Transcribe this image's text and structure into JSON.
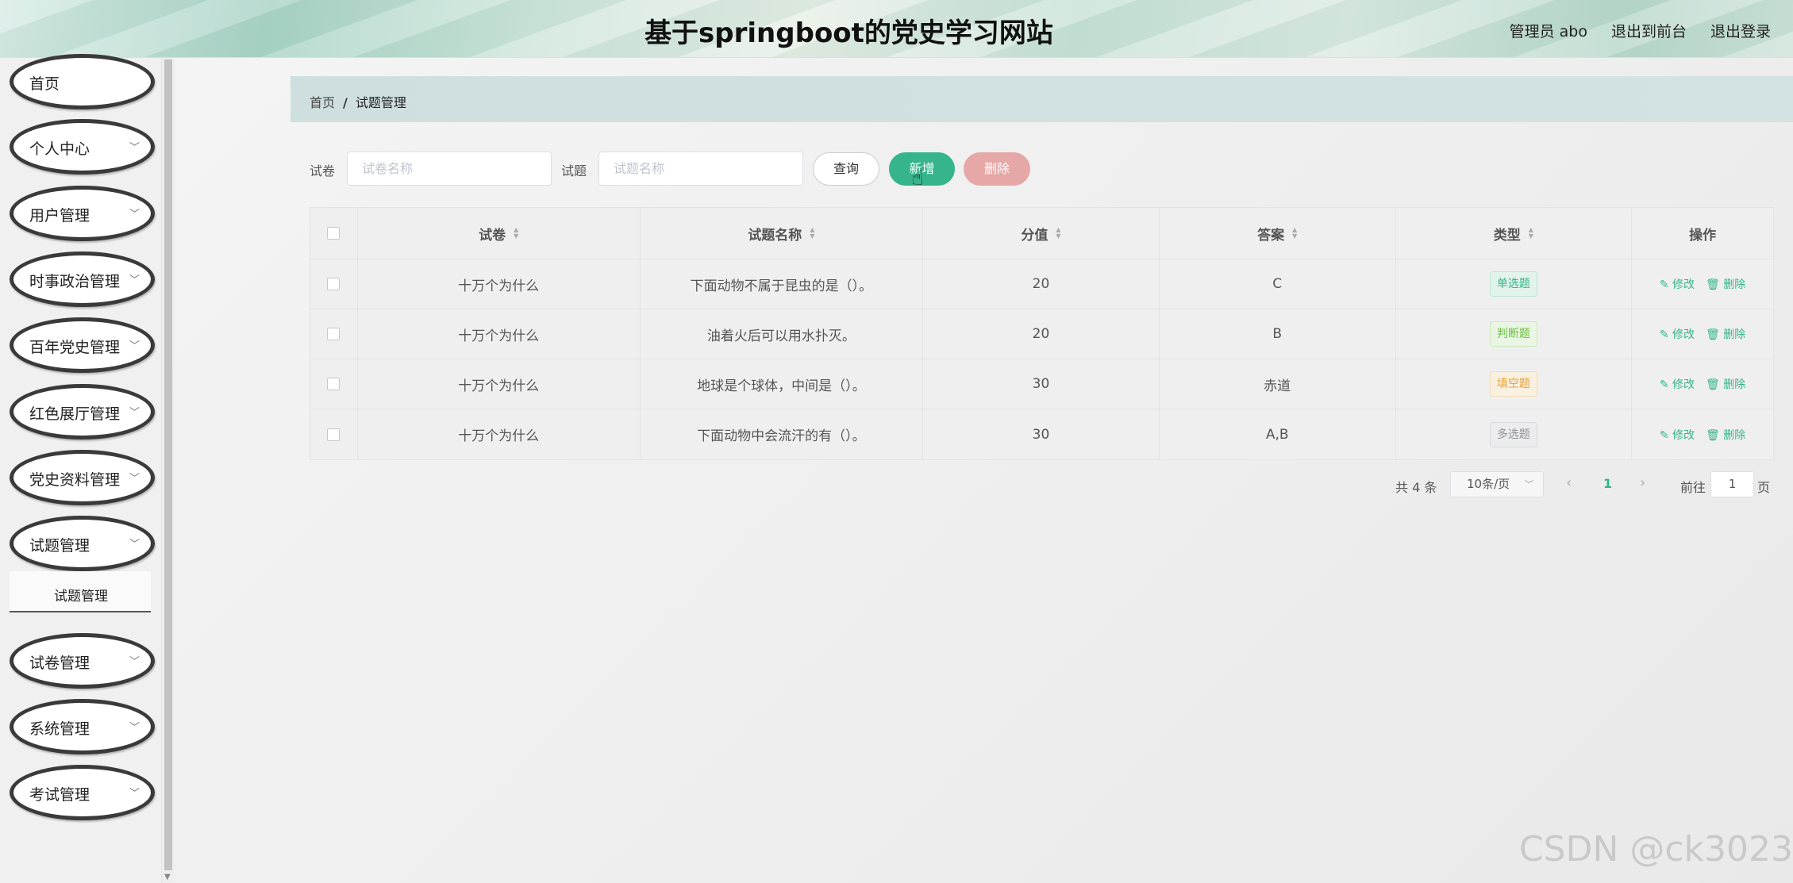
{
  "header": {
    "title": "基于springboot的党史学习网站",
    "admin_label": "管理员 abo",
    "to_front": "退出到前台",
    "logout": "退出登录"
  },
  "sidebar": {
    "items": [
      {
        "label": "首页"
      },
      {
        "label": "个人中心"
      },
      {
        "label": "用户管理"
      },
      {
        "label": "时事政治管理"
      },
      {
        "label": "百年党史管理"
      },
      {
        "label": "红色展厅管理"
      },
      {
        "label": "党史资料管理"
      },
      {
        "label": "试题管理"
      },
      {
        "label": "试卷管理"
      },
      {
        "label": "系统管理"
      },
      {
        "label": "考试管理"
      }
    ],
    "active_sub": "试题管理"
  },
  "breadcrumb": {
    "home": "首页",
    "separator": "/",
    "current": "试题管理"
  },
  "search": {
    "paper_label": "试卷",
    "paper_placeholder": "试卷名称",
    "question_label": "试题",
    "question_placeholder": "试题名称",
    "query_btn": "查询",
    "add_btn": "新增",
    "delete_btn": "删除"
  },
  "table": {
    "headers": {
      "paper": "试卷",
      "title": "试题名称",
      "score": "分值",
      "answer": "答案",
      "type": "类型",
      "ops": "操作"
    },
    "edit_label": "修改",
    "delete_label": "删除",
    "rows": [
      {
        "paper": "十万个为什么",
        "title": "下面动物不属于昆虫的是（）。",
        "score": "20",
        "answer": "C",
        "type": "单选题"
      },
      {
        "paper": "十万个为什么",
        "title": "油着火后可以用水扑灭。",
        "score": "20",
        "answer": "B",
        "type": "判断题"
      },
      {
        "paper": "十万个为什么",
        "title": "地球是个球体，中间是（）。",
        "score": "30",
        "answer": "赤道",
        "type": "填空题"
      },
      {
        "paper": "十万个为什么",
        "title": "下面动物中会流汗的有（）。",
        "score": "30",
        "answer": "A,B",
        "type": "多选题"
      }
    ]
  },
  "pagination": {
    "total": "共 4 条",
    "page_size": "10条/页",
    "current_page": "1",
    "goto_prefix": "前往",
    "goto_value": "1",
    "goto_suffix": "页"
  },
  "watermark": "CSDN @ck3023",
  "colors": {
    "accent": "#36b48c",
    "danger": "#e6a7a7"
  }
}
